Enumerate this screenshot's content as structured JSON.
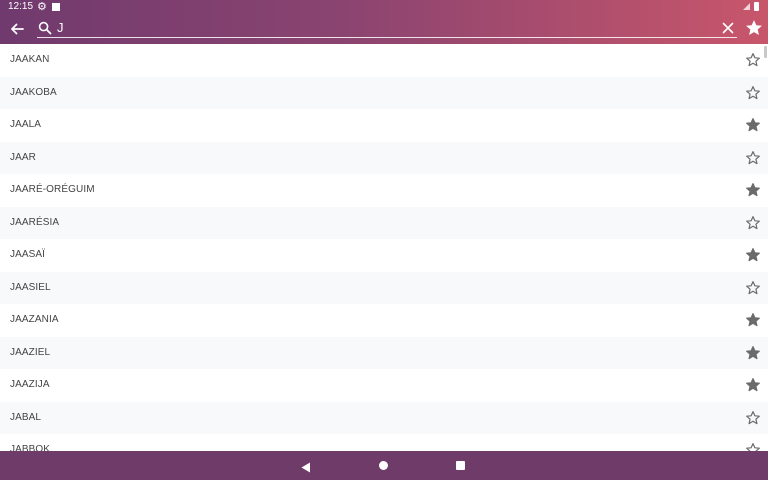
{
  "status_bar": {
    "time": "12:15"
  },
  "toolbar": {
    "search_value": "J",
    "icons": {
      "back": "arrow-left-icon",
      "search": "search-icon",
      "clear": "close-icon",
      "favorites_filter": "star-filled-icon"
    }
  },
  "list": {
    "items": [
      {
        "label": "JAAKAN",
        "favorite": false
      },
      {
        "label": "JAAKOBA",
        "favorite": false
      },
      {
        "label": "JAALA",
        "favorite": true
      },
      {
        "label": "JAAR",
        "favorite": false
      },
      {
        "label": "JAARÉ-ORÉGUIM",
        "favorite": true
      },
      {
        "label": "JAARÉSIA",
        "favorite": false
      },
      {
        "label": "JAASAÏ",
        "favorite": true
      },
      {
        "label": "JAASIEL",
        "favorite": false
      },
      {
        "label": "JAAZANIA",
        "favorite": true
      },
      {
        "label": "JAAZIEL",
        "favorite": true
      },
      {
        "label": "JAAZIJA",
        "favorite": true
      },
      {
        "label": "JABAL",
        "favorite": false
      },
      {
        "label": "JABBOK",
        "favorite": false
      }
    ]
  },
  "colors": {
    "header_gradient_start": "#703a6e",
    "header_gradient_end": "#c8566b",
    "nav_bar": "#6f3b69",
    "star": "#6b6b6b"
  }
}
